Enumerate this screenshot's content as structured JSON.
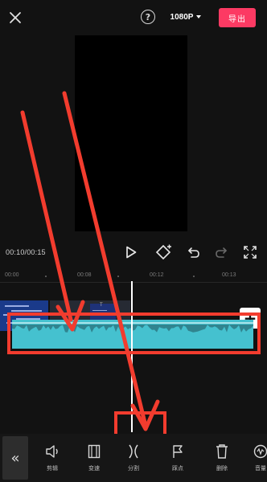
{
  "header": {
    "resolution": "1080P",
    "export_label": "导出",
    "help_symbol": "?"
  },
  "player": {
    "time": "00:10/00:15"
  },
  "ruler": {
    "labels": [
      "00:00",
      "00:08",
      "00:12",
      "00:13"
    ]
  },
  "timeline": {
    "add_clip_symbol": "+",
    "mid_clip_label": "T"
  },
  "toolbar": {
    "back_symbol": "«",
    "tools": [
      {
        "label": "剪辑",
        "icon": "trim-icon"
      },
      {
        "label": "变速",
        "icon": "speed-icon"
      },
      {
        "label": "分割",
        "icon": "split-icon"
      },
      {
        "label": "踩点",
        "icon": "flag-icon"
      },
      {
        "label": "删除",
        "icon": "trash-icon"
      },
      {
        "label": "音量",
        "icon": "volume-icon"
      }
    ]
  },
  "annotation": {
    "color": "#f23c2e",
    "highlights": [
      "audio-track",
      "split-tool"
    ]
  },
  "colors": {
    "export_button": "#fc3a63",
    "audio_waveform": "#45c1cf",
    "background": "#121212"
  }
}
